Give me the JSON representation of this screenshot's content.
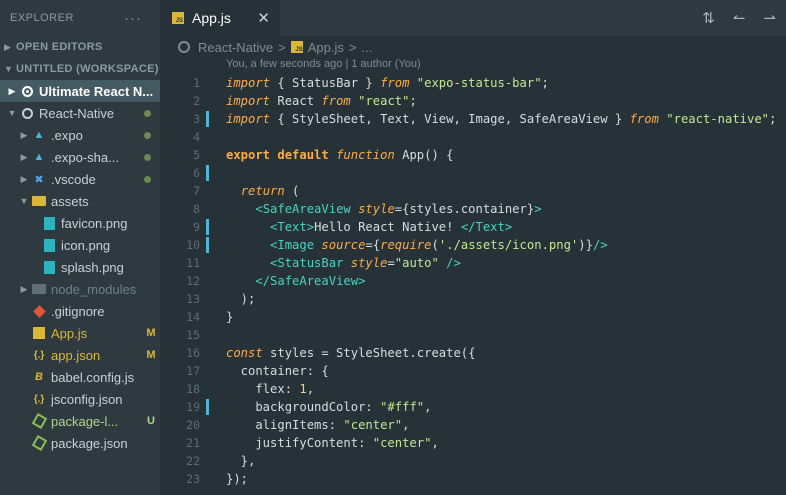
{
  "sidebar": {
    "title": "EXPLORER",
    "more": "···",
    "sections": {
      "open_editors": "OPEN EDITORS",
      "workspace": "UNTITLED (WORKSPACE)"
    },
    "items": [
      {
        "label": "Ultimate React N...",
        "icon": "root-folder-icon"
      },
      {
        "label": "React-Native",
        "icon": "root-folder-icon"
      },
      {
        "label": ".expo",
        "icon": "folder-expo-icon"
      },
      {
        "label": ".expo-sha...",
        "icon": "folder-expo-icon"
      },
      {
        "label": ".vscode",
        "icon": "folder-vscode-icon"
      },
      {
        "label": "assets",
        "icon": "folder-open-icon"
      },
      {
        "label": "favicon.png",
        "icon": "image-file-icon"
      },
      {
        "label": "icon.png",
        "icon": "image-file-icon"
      },
      {
        "label": "splash.png",
        "icon": "image-file-icon"
      },
      {
        "label": "node_modules",
        "icon": "folder-node-icon"
      },
      {
        "label": ".gitignore",
        "icon": "git-icon"
      },
      {
        "label": "App.js",
        "icon": "js-file-icon",
        "badge": "M"
      },
      {
        "label": "app.json",
        "icon": "json-file-icon",
        "badge": "M"
      },
      {
        "label": "babel.config.js",
        "icon": "babel-icon"
      },
      {
        "label": "jsconfig.json",
        "icon": "json-file-icon"
      },
      {
        "label": "package-l...",
        "icon": "node-file-icon",
        "badge": "U"
      },
      {
        "label": "package.json",
        "icon": "node-file-icon"
      }
    ]
  },
  "tab": {
    "label": "App.js",
    "close": "✕",
    "icon_text": "JS"
  },
  "breadcrumb": {
    "folder": "React-Native",
    "sep": ">",
    "file": "App.js",
    "more": "..."
  },
  "codelens": "You, a few seconds ago | 1 author (You)",
  "colors": {
    "sidebar_bg": "#2e3a40",
    "editor_bg": "#263238",
    "accent": "#4fb4d8",
    "keyword": "#ffab40",
    "string": "#c3e88d",
    "tag": "#42d4c2"
  },
  "code": {
    "line_numbers": [
      "1",
      "2",
      "3",
      "4",
      "5",
      "6",
      "7",
      "8",
      "9",
      "10",
      "11",
      "12",
      "13",
      "14",
      "15",
      "16",
      "17",
      "18",
      "19",
      "20",
      "21",
      "22",
      "23"
    ],
    "l1": {
      "kw": "import",
      "a": " { StatusBar } ",
      "kw2": "from",
      "sp": " ",
      "str": "\"expo-status-bar\"",
      "end": ";"
    },
    "l2": {
      "kw": "import",
      "a": " React ",
      "kw2": "from",
      "sp": " ",
      "str": "\"react\"",
      "end": ";"
    },
    "l3": {
      "kw": "import",
      "a": " { StyleSheet, Text, View, Image, SafeAreaView } ",
      "kw2": "from",
      "sp": " ",
      "str": "\"react-native\"",
      "end": ";"
    },
    "l5": {
      "kw": "export default",
      "sp": " ",
      "kw2": "function",
      "a": " App() {"
    },
    "l7": {
      "indent": "  ",
      "kw": "return",
      "a": " ("
    },
    "l8": {
      "indent": "    ",
      "tag": "<SafeAreaView",
      "sp": " ",
      "attr": "style",
      "a": "={styles.container}",
      "tagend": ">"
    },
    "l9": {
      "indent": "      ",
      "tag": "<Text>",
      "a": "Hello React Native! ",
      "tagend": "</Text>"
    },
    "l10": {
      "indent": "      ",
      "tag": "<Image",
      "sp": " ",
      "attr": "source",
      "a": "={",
      "fn": "require",
      "b": "(",
      "str": "'./assets/icon.png'",
      "c": ")}",
      "tagend": "/>"
    },
    "l11": {
      "indent": "      ",
      "tag": "<StatusBar",
      "sp": " ",
      "attr": "style",
      "a": "=",
      "str": "\"auto\"",
      "sp2": " ",
      "tagend": "/>"
    },
    "l12": {
      "indent": "    ",
      "tag": "</SafeAreaView>"
    },
    "l13": {
      "a": "  );"
    },
    "l14": {
      "a": "}"
    },
    "l16": {
      "kw": "const",
      "a": " styles = StyleSheet.create({"
    },
    "l17": {
      "a": "  container: {"
    },
    "l18": {
      "a": "    flex: ",
      "num": "1",
      "end": ","
    },
    "l19": {
      "a": "    backgroundColor: ",
      "str": "\"#fff\"",
      "end": ","
    },
    "l20": {
      "a": "    alignItems: ",
      "str": "\"center\"",
      "end": ","
    },
    "l21": {
      "a": "    justifyContent: ",
      "str": "\"center\"",
      "end": ","
    },
    "l22": {
      "a": "  },"
    },
    "l23": {
      "a": "});"
    }
  }
}
